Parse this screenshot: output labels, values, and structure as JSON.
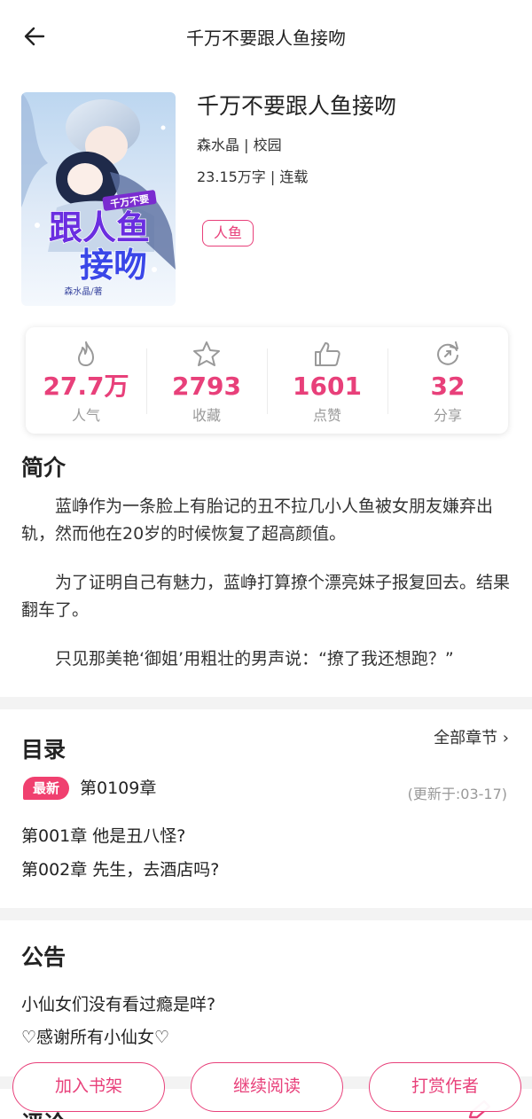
{
  "header": {
    "title": "千万不要跟人鱼接吻",
    "back_icon": "arrow-left-icon"
  },
  "book": {
    "title": "千万不要跟人鱼接吻",
    "author_category": "森水晶 | 校园",
    "words_status": "23.15万字 | 连载",
    "tag": "人鱼",
    "cover": {
      "small_title": "千万不要",
      "big_title_line1": "跟人鱼",
      "big_title_line2": "接吻",
      "author": "森水晶/著"
    }
  },
  "stats": [
    {
      "icon": "flame-icon",
      "value": "27.7万",
      "label": "人气"
    },
    {
      "icon": "star-icon",
      "value": "2793",
      "label": "收藏"
    },
    {
      "icon": "thumbs-up-icon",
      "value": "1601",
      "label": "点赞"
    },
    {
      "icon": "share-icon",
      "value": "32",
      "label": "分享"
    }
  ],
  "intro": {
    "heading": "简介",
    "paragraphs": [
      "蓝峥作为一条脸上有胎记的丑不拉几小人鱼被女朋友嫌弃出轨，然而他在20岁的时候恢复了超高颜值。",
      "为了证明自己有魅力，蓝峥打算撩个漂亮妹子报复回去。结果翻车了。",
      "只见那美艳‘御姐’用粗壮的男声说：“撩了我还想跑？”"
    ]
  },
  "catalog": {
    "heading": "目录",
    "all_link": "全部章节 ›",
    "latest_badge": "最新",
    "latest_chapter": "第0109章",
    "updated": "(更新于:03-17)",
    "chapters": [
      "第001章 他是丑八怪?",
      "第002章 先生，去酒店吗?"
    ]
  },
  "notice": {
    "heading": "公告",
    "lines": [
      "小仙女们没有看过瘾是咩?",
      "♡感谢所有小仙女♡"
    ]
  },
  "actions": {
    "add_shelf": "加入书架",
    "continue_reading": "继续阅读",
    "tip_author": "打赏作者"
  },
  "next_section": {
    "heading": "评论",
    "icon": "edit-icon"
  },
  "colors": {
    "accent": "#e8407a",
    "badge": "#f0406f",
    "muted": "#999999"
  }
}
